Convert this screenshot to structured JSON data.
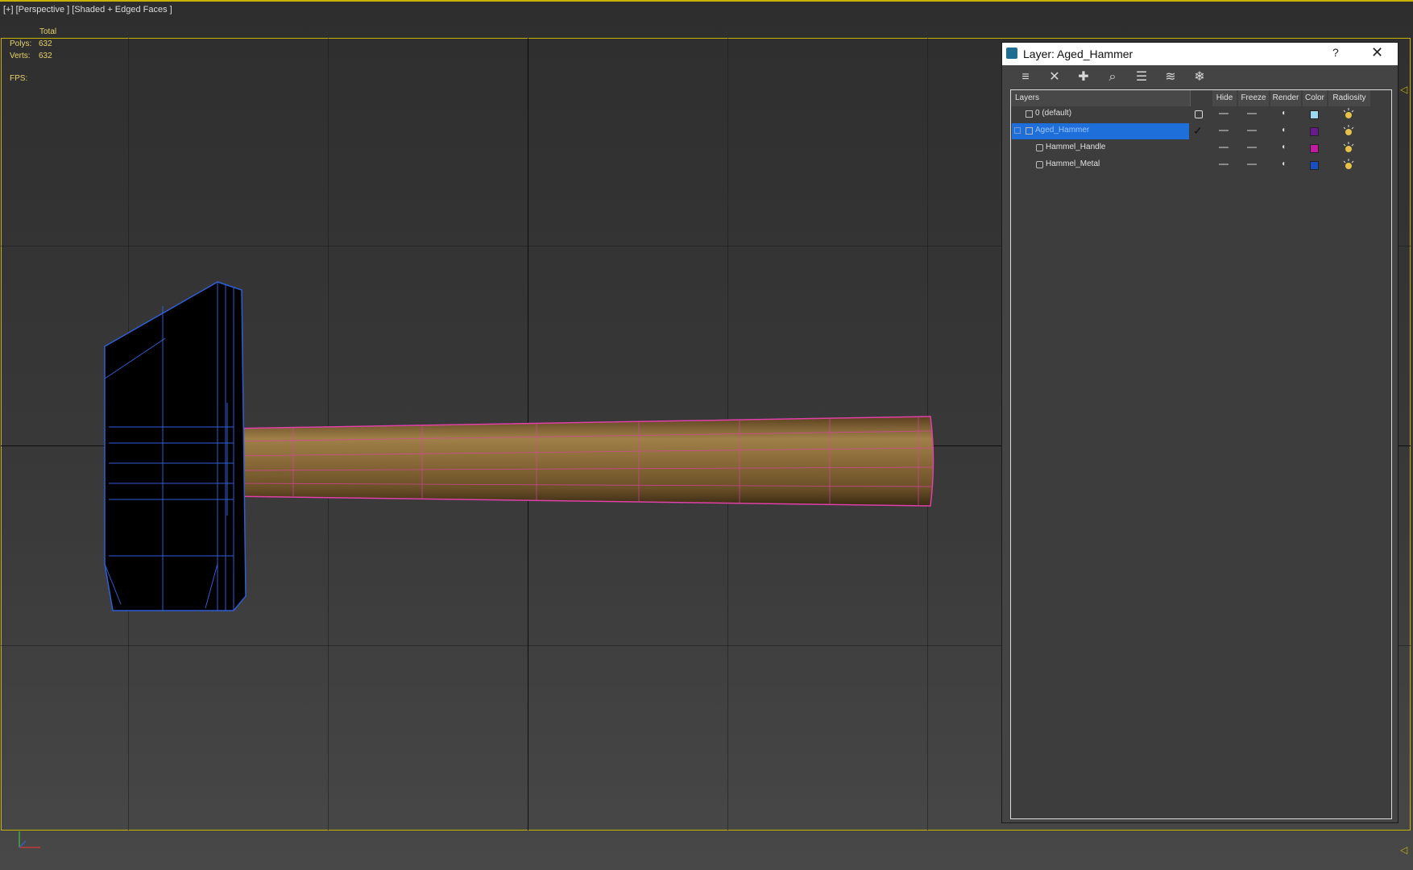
{
  "viewport": {
    "label": "[+] [Perspective ] [Shaded + Edged Faces ]",
    "stats": {
      "total_label": "Total",
      "polys_label": "Polys:",
      "polys_value": "632",
      "verts_label": "Verts:",
      "verts_value": "632",
      "fps_label": "FPS:"
    },
    "colors": {
      "frame": "#c8b400",
      "head_wire": "#2e5fd6",
      "handle_wire": "#e040a8"
    }
  },
  "dialog": {
    "title": "Layer: Aged_Hammer",
    "help_label": "?",
    "close_label": "✕",
    "toolbar": [
      "new-layer-icon",
      "delete-layer-icon",
      "add-to-layer-icon",
      "select-in-layer-icon",
      "highlight-icon",
      "hide-all-icon",
      "freeze-all-icon"
    ],
    "columns": {
      "layers": "Layers",
      "hide": "Hide",
      "freeze": "Freeze",
      "render": "Render",
      "color": "Color",
      "radiosity": "Radiosity"
    },
    "rows": [
      {
        "name": "0 (default)",
        "color": "#9fd6f0",
        "current": "box"
      },
      {
        "name": "Aged_Hammer",
        "color": "#6a1a8a",
        "current": "check",
        "selected": true
      },
      {
        "name": "Hammel_Handle",
        "color": "#c21aa0",
        "current": ""
      },
      {
        "name": "Hammel_Metal",
        "color": "#1a4fc2",
        "current": ""
      }
    ]
  }
}
